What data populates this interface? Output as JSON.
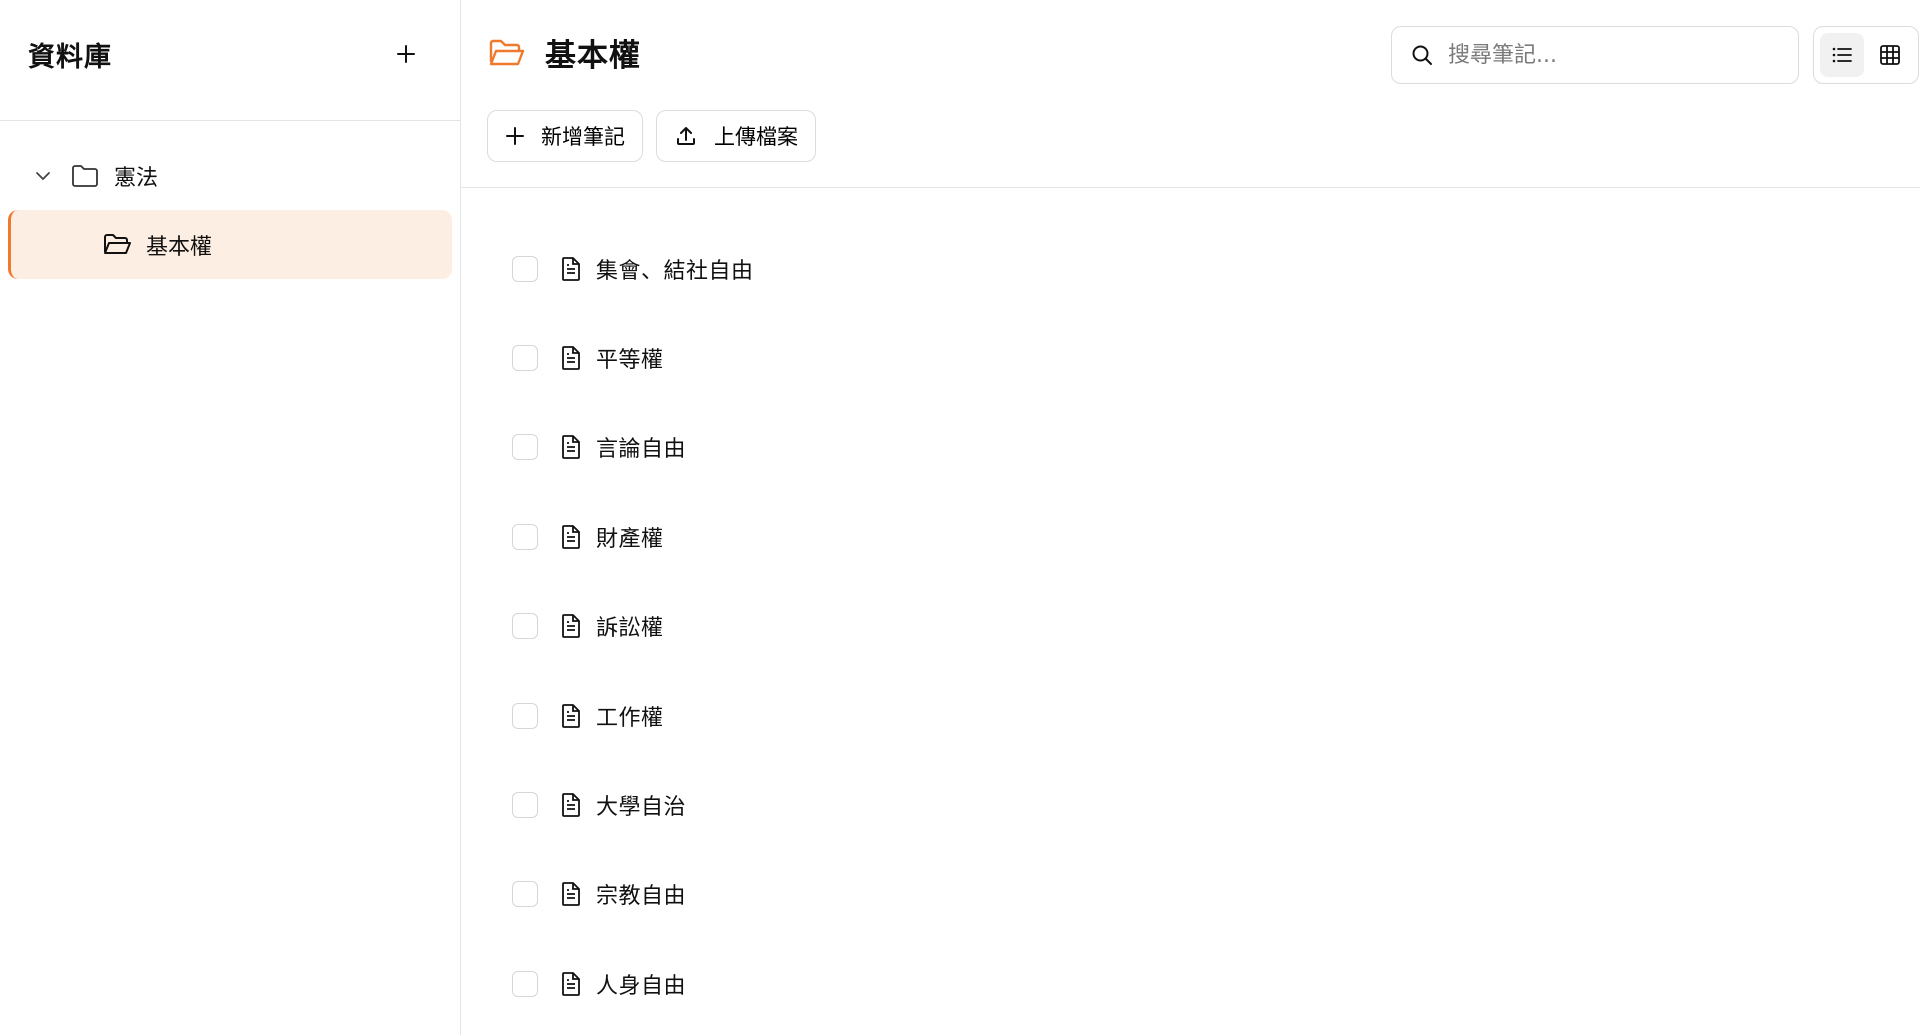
{
  "sidebar": {
    "title": "資料庫",
    "tree": {
      "root_label": "憲法",
      "child_label": "基本權"
    }
  },
  "header": {
    "title": "基本權",
    "search_placeholder": "搜尋筆記...",
    "new_note_label": "新增筆記",
    "upload_label": "上傳檔案",
    "view_mode": "list"
  },
  "notes": [
    {
      "title": "集會、結社自由"
    },
    {
      "title": "平等權"
    },
    {
      "title": "言論自由"
    },
    {
      "title": "財產權"
    },
    {
      "title": "訴訟權"
    },
    {
      "title": "工作權"
    },
    {
      "title": "大學自治"
    },
    {
      "title": "宗教自由"
    },
    {
      "title": "人身自由"
    }
  ],
  "colors": {
    "accent": "#ef7a2e",
    "selected_bg": "#fdeee3"
  },
  "icons": {
    "add": "plus-icon",
    "folder": "folder-icon",
    "folder_open": "folder-open-icon",
    "chevron": "chevron-down-icon",
    "search": "search-icon",
    "list_view": "list-view-icon",
    "grid_view": "grid-view-icon",
    "upload": "upload-icon",
    "document": "document-icon"
  }
}
